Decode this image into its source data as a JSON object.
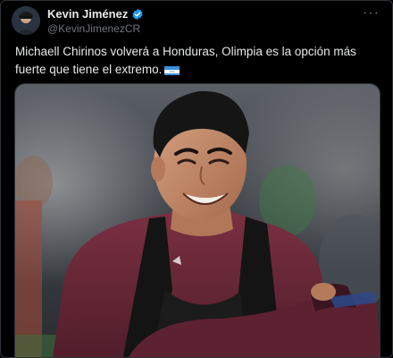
{
  "author": {
    "display_name": "Kevin Jiménez",
    "handle": "@KevinJimenezCR",
    "verified": true
  },
  "icons": {
    "verified": "verified-badge-icon",
    "more": "more-options-icon",
    "flag": "honduras-flag-icon"
  },
  "tweet": {
    "text": "Michaell Chirinos volverá a Honduras, Olimpia es la opción más fuerte que tiene el extremo."
  },
  "colors": {
    "background": "#000000",
    "text": "#e7e9ea",
    "muted": "#71767b",
    "verified": "#1d9bf0",
    "jersey": "#6e2a3a"
  }
}
